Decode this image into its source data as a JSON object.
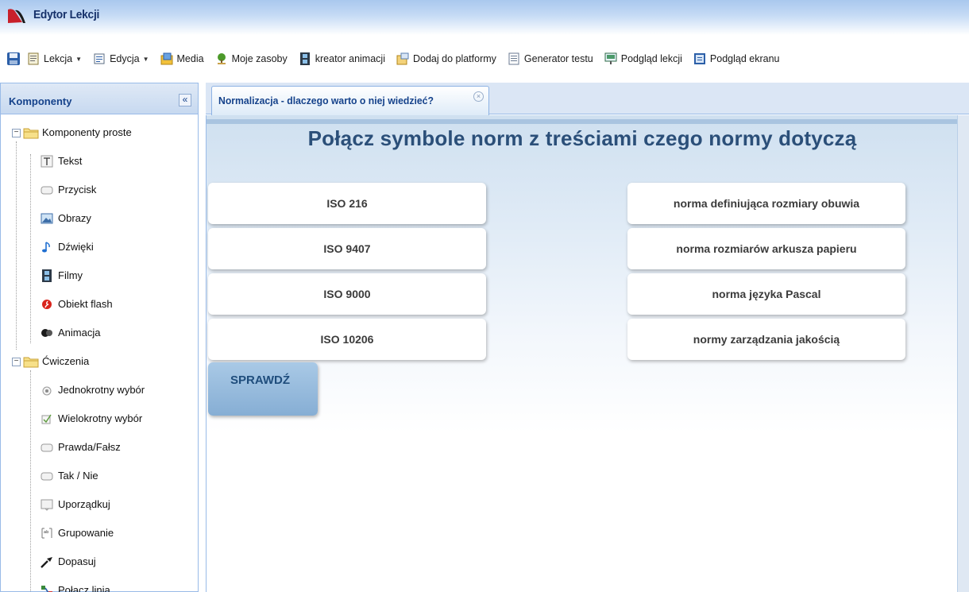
{
  "window": {
    "title": "Edytor Lekcji"
  },
  "toolbar": {
    "items": [
      {
        "label": "Lekcja",
        "icon": "lesson-icon",
        "dropdown": true
      },
      {
        "label": "Edycja",
        "icon": "edit-icon",
        "dropdown": true
      },
      {
        "label": "Media",
        "icon": "media-icon"
      },
      {
        "label": "Moje zasoby",
        "icon": "resources-icon"
      },
      {
        "label": "kreator animacji",
        "icon": "film-icon"
      },
      {
        "label": "Dodaj do platformy",
        "icon": "platform-icon"
      },
      {
        "label": "Generator testu",
        "icon": "test-icon"
      },
      {
        "label": "Podgląd lekcji",
        "icon": "presentation-icon"
      },
      {
        "label": "Podgląd ekranu",
        "icon": "screen-icon"
      }
    ]
  },
  "sidebar": {
    "title": "Komponenty",
    "collapse_glyph": "«",
    "groups": [
      {
        "label": "Komponenty proste",
        "toggle": "−",
        "items": [
          {
            "label": "Tekst",
            "icon": "text-icon"
          },
          {
            "label": "Przycisk",
            "icon": "button-icon"
          },
          {
            "label": "Obrazy",
            "icon": "image-icon"
          },
          {
            "label": "Dźwięki",
            "icon": "music-note-icon"
          },
          {
            "label": "Filmy",
            "icon": "film-icon"
          },
          {
            "label": "Obiekt flash",
            "icon": "flash-icon"
          },
          {
            "label": "Animacja",
            "icon": "animation-icon"
          }
        ]
      },
      {
        "label": "Ćwiczenia",
        "toggle": "−",
        "items": [
          {
            "label": "Jednokrotny wybór",
            "icon": "radio-icon"
          },
          {
            "label": "Wielokrotny wybór",
            "icon": "checkbox-icon"
          },
          {
            "label": "Prawda/Fałsz",
            "icon": "true-false-icon"
          },
          {
            "label": "Tak / Nie",
            "icon": "yes-no-icon"
          },
          {
            "label": "Uporządkuj",
            "icon": "order-icon"
          },
          {
            "label": "Grupowanie",
            "icon": "grouping-icon"
          },
          {
            "label": "Dopasuj",
            "icon": "match-icon"
          },
          {
            "label": "Połącz linią",
            "icon": "connect-icon"
          }
        ]
      }
    ]
  },
  "tab": {
    "label": "Normalizacja - dlaczego warto o niej wiedzieć?",
    "close_glyph": "×"
  },
  "exercise": {
    "heading": "Połącz symbole norm z treściami czego normy dotyczą",
    "left": [
      "ISO 216",
      "ISO 9407",
      "ISO 9000",
      "ISO 10206"
    ],
    "right": [
      "norma definiująca rozmiary obuwia",
      "norma rozmiarów arkusza papieru",
      "norma języka Pascal",
      "normy zarządzania jakością"
    ],
    "check_label": "SPRAWDŹ"
  },
  "colors": {
    "accent": "#15428b",
    "heading": "#2b4f79",
    "border": "#99bbe8"
  }
}
